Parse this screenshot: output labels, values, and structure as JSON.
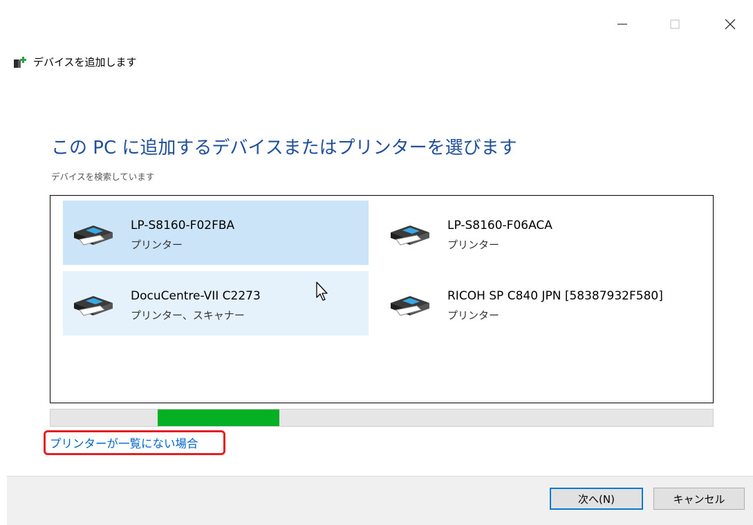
{
  "window": {
    "title": "デバイスを追加します",
    "controls": [
      "minimize-icon",
      "maximize-icon",
      "close-icon"
    ]
  },
  "main": {
    "heading": "この PC に追加するデバイスまたはプリンターを選びます",
    "status": "デバイスを検索しています"
  },
  "devices": [
    {
      "name": "LP-S8160-F02FBA",
      "type": "プリンター",
      "state": "selected",
      "icon": "printer-icon"
    },
    {
      "name": "LP-S8160-F06ACA",
      "type": "プリンター",
      "state": "normal",
      "icon": "printer-icon"
    },
    {
      "name": "DocuCentre-VII C2273",
      "type": "プリンター、スキャナー",
      "state": "hover",
      "icon": "printer-icon"
    },
    {
      "name": "RICOH SP C840 JPN [58387932F580]",
      "type": "プリンター",
      "state": "normal",
      "icon": "printer-icon"
    }
  ],
  "progress": {
    "indeterminate": true,
    "color": "#06b025"
  },
  "link": {
    "text": "プリンターが一覧にない場合",
    "highlight_color": "#e31e24"
  },
  "footer": {
    "next_label": "次へ(N)",
    "cancel_label": "キャンセル"
  },
  "colors": {
    "heading": "#1f4e9b",
    "selected": "#cce4f7",
    "hover": "#e5f1fb",
    "link": "#0066cc",
    "focus_border": "#0078d7"
  }
}
